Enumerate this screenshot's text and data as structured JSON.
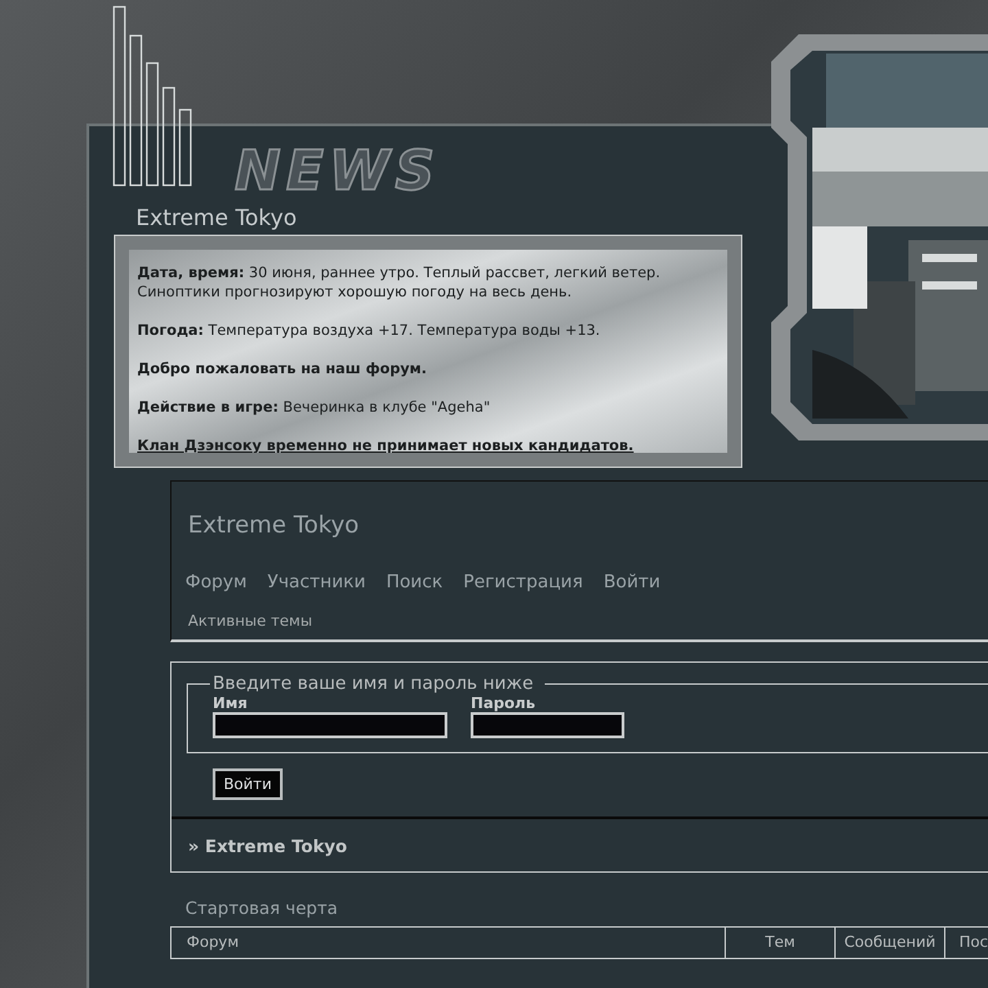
{
  "logo": "NEWS",
  "news": {
    "title": "Extreme Tokyo",
    "paragraphs": [
      {
        "label": "Дата, время:",
        "text": "30 июня, раннее утро. Теплый рассвет, легкий ветер. Синоптики прогнозируют хорошую погоду на весь день."
      },
      {
        "label": "Погода:",
        "text": "Температура воздуха +17. Температура воды +13."
      },
      {
        "label": "Добро пожаловать на наш форум."
      },
      {
        "label": "Действие в игре:",
        "text": "Вечеринка в клубе \"Ageha\""
      },
      {
        "label": "Клан Дзэнсоку временно не принимает новых кандидатов."
      }
    ]
  },
  "header": {
    "title": "Extreme Tokyo",
    "nav": [
      "Форум",
      "Участники",
      "Поиск",
      "Регистрация",
      "Войти"
    ],
    "active_topics": "Активные темы"
  },
  "login": {
    "legend": "Введите ваше имя и пароль ниже",
    "fields": [
      {
        "label": "Имя"
      },
      {
        "label": "Пароль"
      }
    ],
    "button": "Войти"
  },
  "breadcrumb": "» Extreme Tokyo",
  "category": "Стартовая черта",
  "table": {
    "columns": [
      "Форум",
      "Тем",
      "Сообщений",
      "Пос"
    ]
  }
}
